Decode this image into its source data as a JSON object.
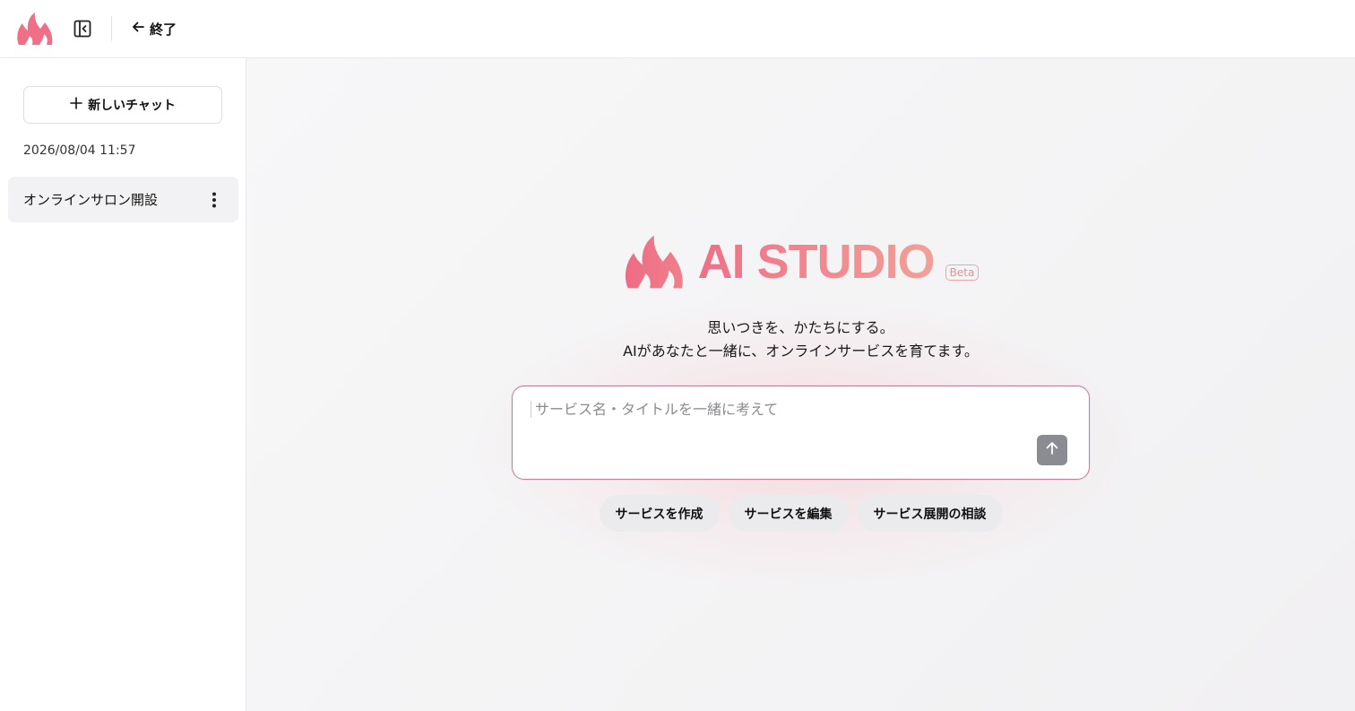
{
  "header": {
    "exit_label": "終了"
  },
  "sidebar": {
    "new_chat_label": "新しいチャット",
    "history_date": "2026/08/04 11:57",
    "history_items": [
      {
        "label": "オンラインサロン開設"
      }
    ]
  },
  "hero": {
    "brand": "AI STUDIO",
    "beta": "Beta",
    "tagline_line1": "思いつきを、かたちにする。",
    "tagline_line2": "AIがあなたと一緒に、オンラインサービスを育てます。"
  },
  "prompt": {
    "placeholder": "サービス名・タイトルを一緒に考えて",
    "value": ""
  },
  "suggestions": [
    {
      "label": "サービスを作成"
    },
    {
      "label": "サービスを編集"
    },
    {
      "label": "サービス展開の相談"
    }
  ],
  "colors": {
    "brand_pink": "#ef6f86",
    "brand_coral": "#f1a199",
    "send_button": "#8b8c91"
  },
  "icons": {
    "logo": "flame-logo-icon",
    "sidebar_toggle": "sidebar-toggle-icon",
    "exit": "arrow-left-icon",
    "new_chat": "plus-icon",
    "history_menu": "more-vertical-icon",
    "send": "arrow-up-icon"
  }
}
